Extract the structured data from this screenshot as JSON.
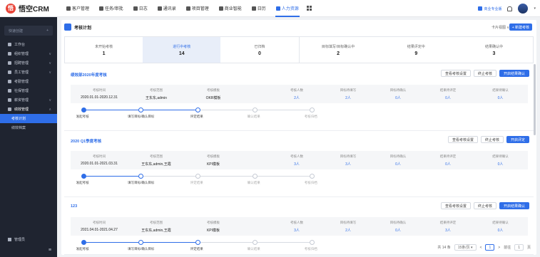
{
  "app": {
    "logo_mark": "悟",
    "name": "悟空CRM"
  },
  "nav": {
    "items": [
      {
        "label": "客户管理",
        "icon": "customer-icon"
      },
      {
        "label": "任务/审批",
        "icon": "task-icon"
      },
      {
        "label": "日志",
        "icon": "log-icon"
      },
      {
        "label": "通讯录",
        "icon": "contacts-icon"
      },
      {
        "label": "项目管理",
        "icon": "project-icon"
      },
      {
        "label": "商业智能",
        "icon": "bi-icon"
      },
      {
        "label": "日历",
        "icon": "calendar-icon"
      },
      {
        "label": "人力资源",
        "icon": "hr-icon",
        "active": true
      }
    ],
    "upgrade": "商业专业版"
  },
  "sidebar": {
    "quick_create": "快速创建",
    "quick_plus": "+",
    "items": [
      {
        "label": "工作台"
      },
      {
        "label": "组织管理",
        "arrow": "∨"
      },
      {
        "label": "招聘管理",
        "arrow": "∨"
      },
      {
        "label": "员工管理",
        "arrow": "∨"
      },
      {
        "label": "考勤管理"
      },
      {
        "label": "社保管理"
      },
      {
        "label": "薪资管理",
        "arrow": "∨"
      },
      {
        "label": "绩效管理",
        "arrow": "∧"
      }
    ],
    "sub_items": [
      {
        "label": "考核计划",
        "active": true
      },
      {
        "label": "绩效档案"
      }
    ],
    "bottom": "管理员",
    "collapse": "≡"
  },
  "page": {
    "title": "考核计划",
    "sort_label": "卡片视图 ∨",
    "new_button": "+ 新建考核"
  },
  "stats": [
    {
      "label": "未开始考核",
      "value": "1"
    },
    {
      "label": "进行中考核",
      "value": "14",
      "active": true
    },
    {
      "label": "已归档",
      "value": "0"
    },
    {
      "label": "目标填写/目标确认中",
      "value": "2"
    },
    {
      "label": "结果评定中",
      "value": "9"
    },
    {
      "label": "结果确认中",
      "value": "3"
    }
  ],
  "info_labels": [
    "考核时间",
    "考核范围",
    "考核模板",
    "考核人数",
    "目标待填写",
    "目标待确认",
    "结果待评定",
    "结果待确认"
  ],
  "steps_labels": [
    "发起考核",
    "填写目标/确认目标",
    "评定结果",
    "确认结果",
    "考核归档"
  ],
  "cards": [
    {
      "title": "绩效部2020年度考核",
      "buttons": [
        "查看考核设置",
        "终止考核",
        "开启结果确认"
      ],
      "values": [
        "2020.01.01-2020.12.31",
        "王东东,admin",
        "OKR模板",
        "2人",
        "2人",
        "0人",
        "0人",
        "0人"
      ],
      "progress": 2
    },
    {
      "title": "2020 Q1季度考核",
      "buttons": [
        "查看考核设置",
        "终止考核",
        "开启评定"
      ],
      "values": [
        "2020.01.01-2021.03.31",
        "王东东,admin,王霞",
        "KPI模板",
        "3人",
        "3人",
        "0人",
        "0人",
        "0人"
      ],
      "progress": 1
    },
    {
      "title": "123",
      "buttons": [
        "查看考核设置",
        "终止考核",
        "开启结果确认"
      ],
      "values": [
        "2021.04.01-2021.04.27",
        "王东东,admin,王霞",
        "KPI模板",
        "3人",
        "2人",
        "0人",
        "3人",
        "0人"
      ],
      "progress": 2
    }
  ],
  "pager": {
    "total": "共 14 条",
    "size": "15条/页",
    "prev": "<",
    "current": "1",
    "next": ">",
    "goto": "前往",
    "goto_value": "1",
    "page_unit": "页"
  }
}
